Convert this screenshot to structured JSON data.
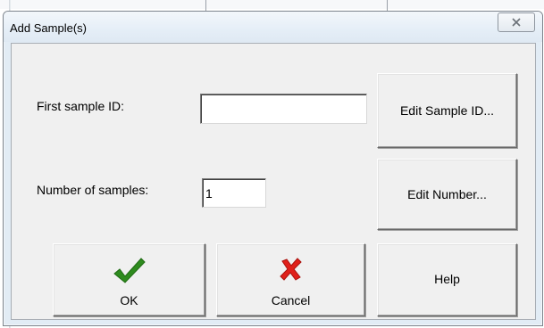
{
  "dialog": {
    "title": "Add Sample(s)",
    "close_glyph": "close-icon"
  },
  "form": {
    "first_sample_id": {
      "label": "First sample ID:",
      "value": ""
    },
    "number_of_samples": {
      "label": "Number of samples:",
      "value": "1"
    }
  },
  "buttons": {
    "edit_sample_id": "Edit Sample ID...",
    "edit_number": "Edit Number...",
    "ok": "OK",
    "cancel": "Cancel",
    "help": "Help"
  },
  "icons": {
    "ok": "checkmark-icon",
    "cancel": "red-x-icon"
  },
  "colors": {
    "ok_check": "#2e8b1e",
    "cancel_x": "#e0201a",
    "dialog_frame": "#e2ecf5",
    "client_bg": "#f0f0f0"
  }
}
